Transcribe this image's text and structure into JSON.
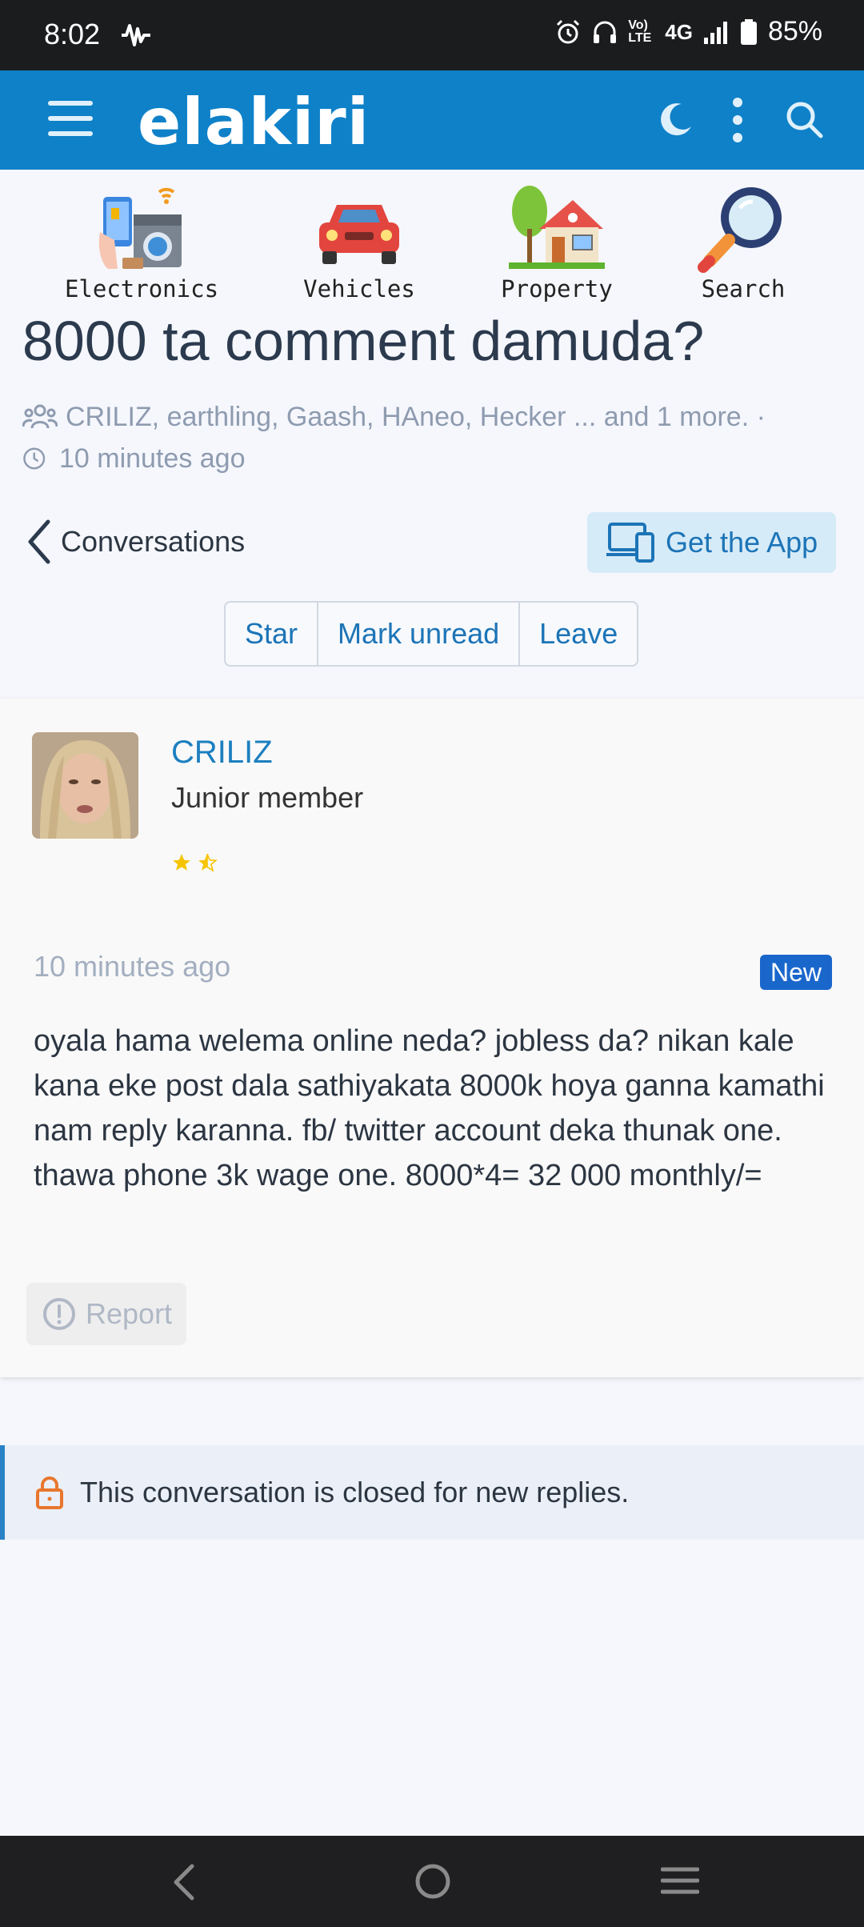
{
  "status_bar": {
    "time": "8:02",
    "battery": "85%",
    "network": "4G",
    "volte": "Vo) LTE",
    "icons": [
      "activity-icon",
      "alarm-icon",
      "headphones-icon",
      "volte-icon",
      "signal-icon",
      "battery-icon"
    ]
  },
  "header": {
    "logo": "elakiri",
    "background": "#0e81c8",
    "icons": [
      "menu-icon",
      "moon-icon",
      "more-vertical-icon",
      "search-icon"
    ]
  },
  "categories": [
    {
      "label": "Electronics",
      "icon": "electronics-icon"
    },
    {
      "label": "Vehicles",
      "icon": "car-icon"
    },
    {
      "label": "Property",
      "icon": "house-icon"
    },
    {
      "label": "Search",
      "icon": "magnifier-icon"
    }
  ],
  "conversation": {
    "title": "8000 ta comment damuda?",
    "participants": "CRILIZ, earthling, Gaash, HAneo, Hecker ... and 1 more. ·",
    "time": "10 minutes ago",
    "back_label": "Conversations",
    "get_app_label": "Get the App",
    "actions": {
      "star": "Star",
      "mark_unread": "Mark unread",
      "leave": "Leave"
    }
  },
  "message": {
    "username": "CRILIZ",
    "user_title": "Junior member",
    "rating": 1.5,
    "time": "10 minutes ago",
    "badge": "New",
    "body": "oyala hama welema online neda? jobless da? nikan kale kana eke post dala sathiyakata 8000k hoya ganna kamathi nam reply karanna. fb/ twitter account deka thunak one. thawa phone 3k wage one. 8000*4= 32 000 monthly/=",
    "report_label": "Report"
  },
  "closed_notice": "This conversation is closed for new replies.",
  "colors": {
    "accent": "#1c74b7",
    "badge": "#1a67cc",
    "lock": "#e8772e",
    "star": "#f5c400"
  }
}
